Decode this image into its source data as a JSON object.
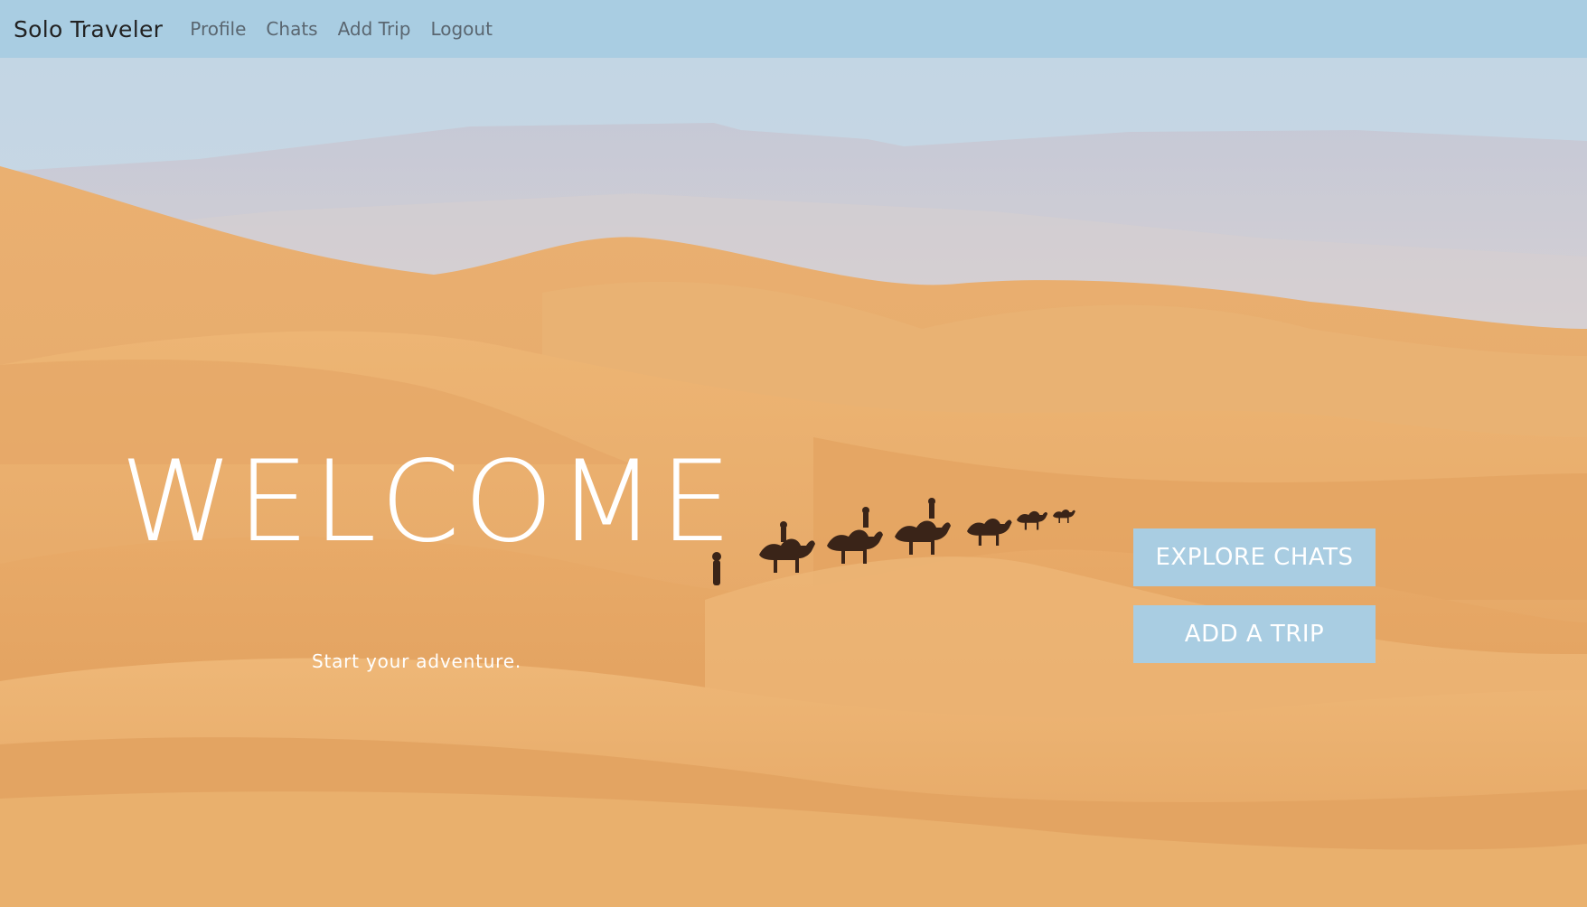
{
  "navbar": {
    "brand": "Solo Traveler",
    "links": [
      {
        "label": "Profile"
      },
      {
        "label": "Chats"
      },
      {
        "label": "Add Trip"
      },
      {
        "label": "Logout"
      }
    ],
    "background_color": "#a9cde2"
  },
  "hero": {
    "background_image": "desert-dunes-camel-caravan",
    "headline": "WELCOME",
    "tagline": "Start your adventure.",
    "buttons": [
      {
        "label": "EXPLORE CHATS"
      },
      {
        "label": "ADD A TRIP"
      }
    ],
    "button_color": "#a9cde2",
    "text_color": "#ffffff"
  }
}
